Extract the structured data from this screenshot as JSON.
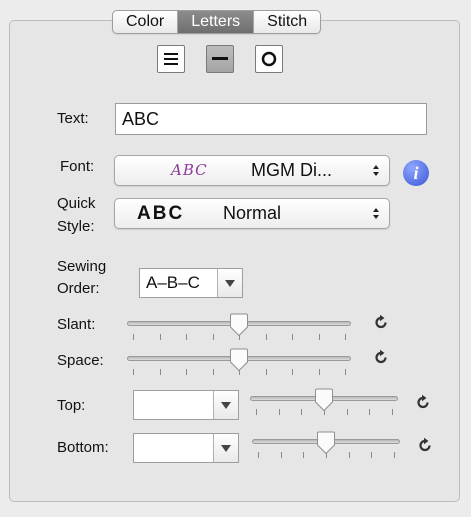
{
  "tabs": [
    {
      "label": "Color"
    },
    {
      "label": "Letters",
      "selected": true
    },
    {
      "label": "Stitch"
    }
  ],
  "mode_buttons": [
    {
      "icon": "lines-icon",
      "selected": false
    },
    {
      "icon": "bar-icon",
      "selected": true
    },
    {
      "icon": "circle-icon",
      "selected": false
    }
  ],
  "text": {
    "label": "Text:",
    "value": "ABC"
  },
  "font": {
    "label": "Font:",
    "preview": "ABC",
    "preview_color": "#8e3a9a",
    "value": "MGM Di..."
  },
  "quick_style": {
    "label_line1": "Quick",
    "label_line2": "Style:",
    "preview": "ABC",
    "value": "Normal"
  },
  "sewing_order": {
    "label_line1": "Sewing",
    "label_line2": "Order:",
    "value": "A–B–C"
  },
  "slant": {
    "label": "Slant:",
    "level": 0.5
  },
  "space": {
    "label": "Space:",
    "level": 0.5
  },
  "top": {
    "label": "Top:",
    "value": "",
    "level": 0.5
  },
  "bottom": {
    "label": "Bottom:",
    "value": "",
    "level": 0.5
  },
  "colors": {
    "info_blue": "#3a56d6",
    "selected_tab": "#7d7d7d"
  }
}
